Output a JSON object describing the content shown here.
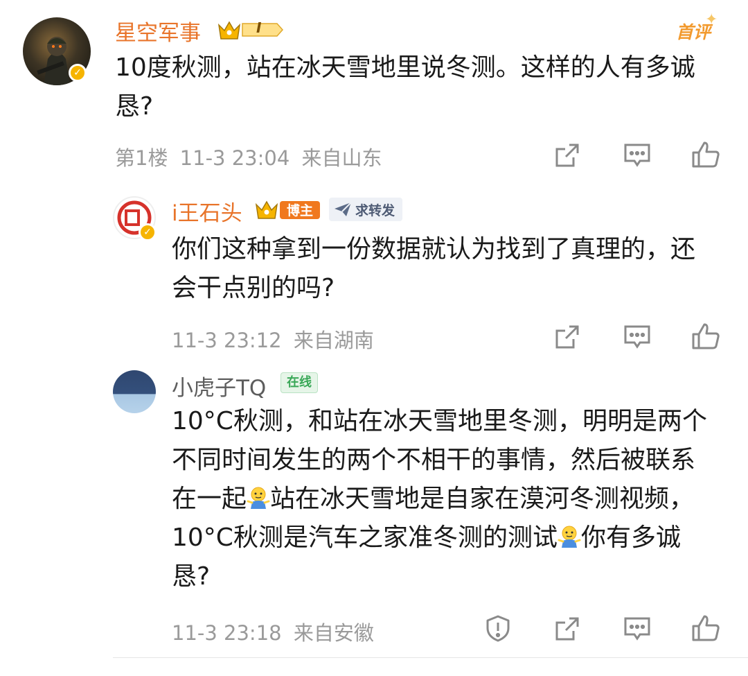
{
  "comments": [
    {
      "username": "星空军事",
      "level_badge": "I",
      "top_label": "首评",
      "text": "10度秋测，站在冰天雪地里说冬测。这样的人有多诚恳?",
      "floor": "第1楼",
      "time": "11-3 23:04",
      "location": "来自山东"
    },
    {
      "username": "i王石头",
      "role_badge": "博主",
      "repost_badge": "求转发",
      "text": "你们这种拿到一份数据就认为找到了真理的，还会干点别的吗?",
      "time": "11-3 23:12",
      "location": "来自湖南"
    },
    {
      "username": "小虎子TQ",
      "status_badge": "在线",
      "text_parts": [
        "10°C秋测，和站在冰天雪地里冬测，明明是两个不同时间发生的两个不相干的事情，然后被联系在一起",
        "站在冰天雪地是自家在漠河冬测视频，10°C秋测是汽车之家准冬测的测试",
        "你有多诚恳?"
      ],
      "time": "11-3 23:18",
      "location": "来自安徽"
    }
  ],
  "icons": [
    "share-icon",
    "comment-icon",
    "like-icon",
    "report-icon",
    "shrug-emoji"
  ],
  "colors": {
    "accent": "#e8742a",
    "gold": "#f6b400",
    "meta": "#9a9a9a"
  }
}
